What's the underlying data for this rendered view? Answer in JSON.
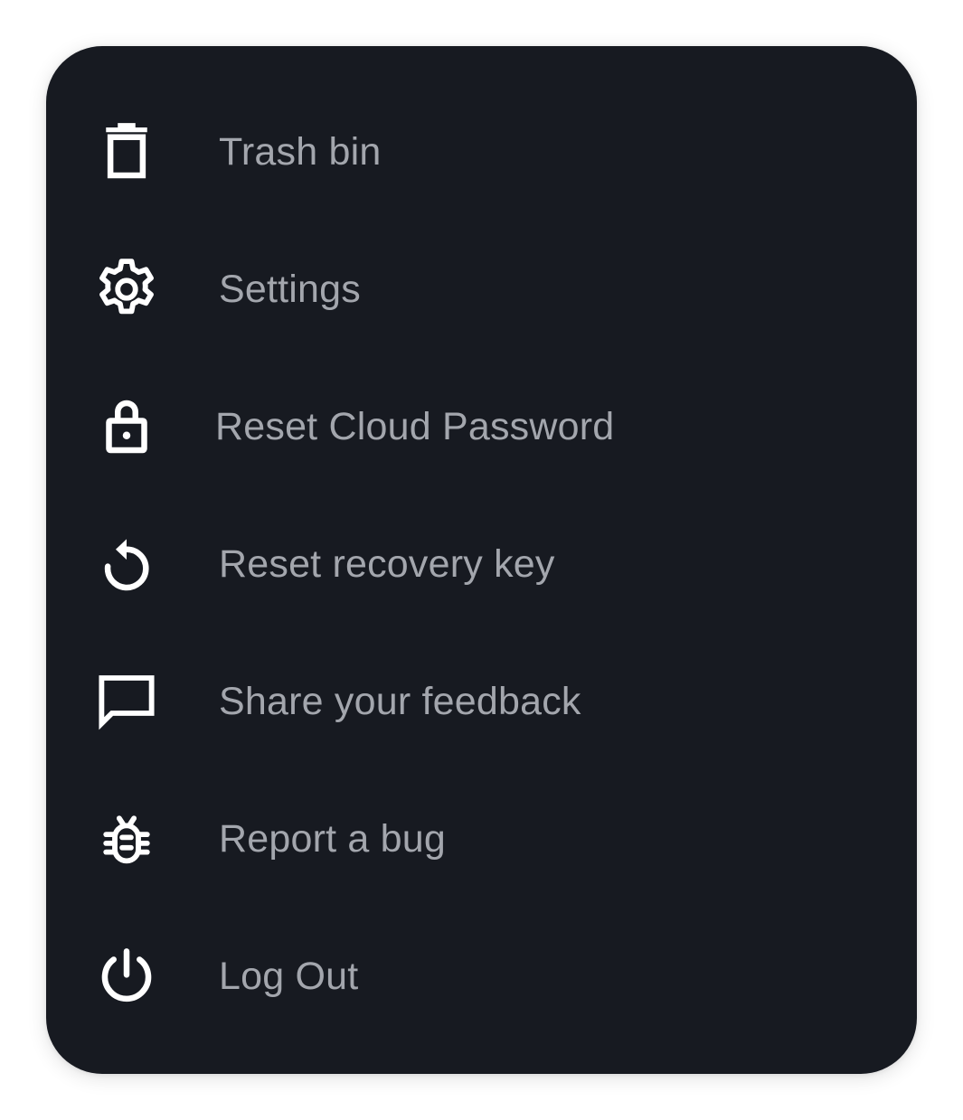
{
  "menu": {
    "items": [
      {
        "label": "Trash bin",
        "icon": "trash-icon"
      },
      {
        "label": "Settings",
        "icon": "gear-icon"
      },
      {
        "label": "Reset Cloud Password",
        "icon": "lock-icon"
      },
      {
        "label": "Reset recovery key",
        "icon": "reset-icon"
      },
      {
        "label": "Share your feedback",
        "icon": "chat-bubble-icon"
      },
      {
        "label": "Report a bug",
        "icon": "bug-icon"
      },
      {
        "label": "Log Out",
        "icon": "power-icon"
      }
    ]
  },
  "colors": {
    "panel_background": "#171a21",
    "label_text": "#a3a6ad",
    "icon": "#ffffff"
  }
}
